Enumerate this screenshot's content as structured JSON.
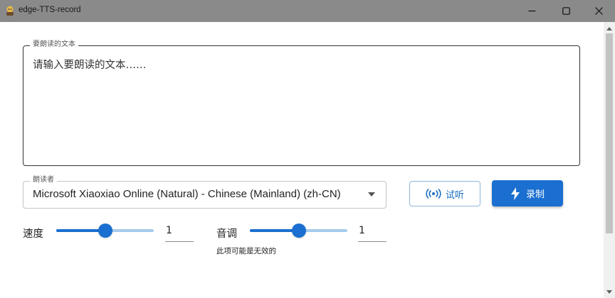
{
  "window": {
    "title": "edge-TTS-record"
  },
  "text_input": {
    "legend": "要朗读的文本",
    "placeholder": "请输入要朗读的文本……"
  },
  "reader": {
    "legend": "朗读者",
    "selected": "Microsoft Xiaoxiao Online (Natural) - Chinese (Mainland) (zh-CN)"
  },
  "buttons": {
    "listen_label": "试听",
    "record_label": "录制"
  },
  "speed": {
    "label": "速度",
    "value": "1",
    "slider_fraction": 0.5
  },
  "pitch": {
    "label": "音调",
    "value": "1",
    "slider_fraction": 0.5,
    "hint": "此项可能是无效的"
  },
  "colors": {
    "primary": "#1a6fd0",
    "rail": "#a6cbee",
    "titlebar": "#8a8a8a"
  }
}
